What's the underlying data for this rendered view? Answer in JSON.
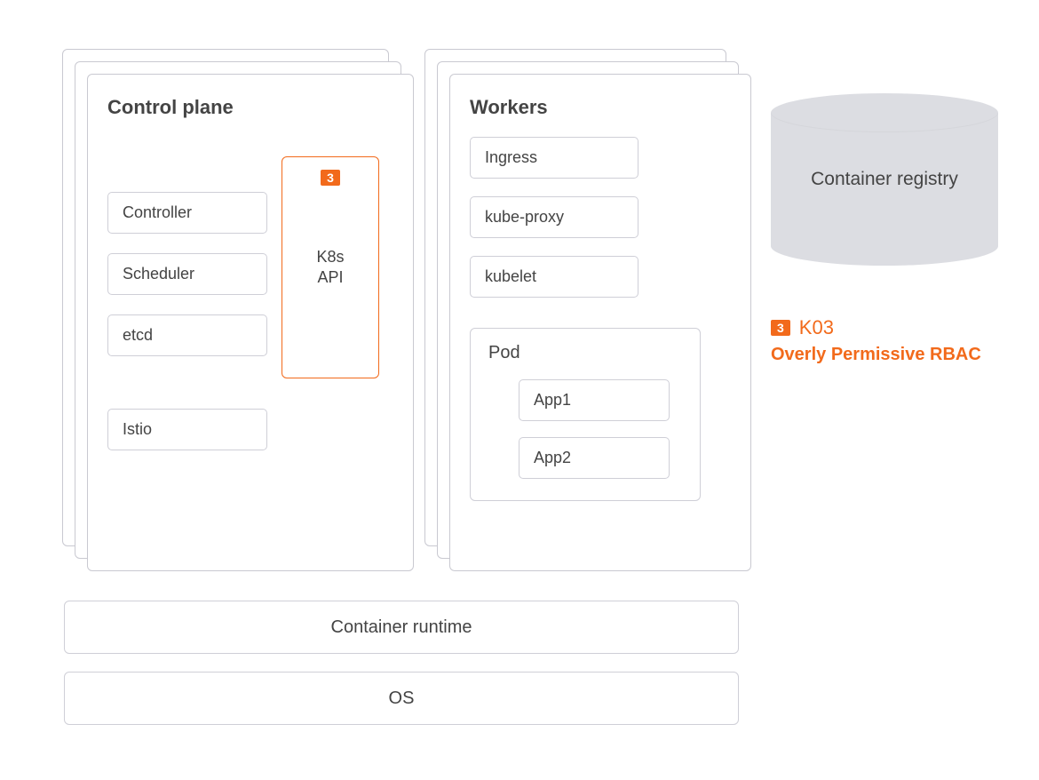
{
  "colors": {
    "accent": "#f26a1b",
    "border": "#c9c9d1",
    "cylinder": "#dcdde2",
    "text": "#333333"
  },
  "controlPlane": {
    "title": "Control plane",
    "left": [
      "Controller",
      "Scheduler",
      "etcd"
    ],
    "api": {
      "badge": "3",
      "label": "K8s\nAPI"
    },
    "below": "Istio"
  },
  "workers": {
    "title": "Workers",
    "items": [
      "Ingress",
      "kube-proxy",
      "kubelet"
    ],
    "pod": {
      "title": "Pod",
      "apps": [
        "App1",
        "App2"
      ]
    }
  },
  "bars": {
    "runtime": "Container runtime",
    "os": "OS"
  },
  "registry": {
    "label": "Container registry"
  },
  "legend": {
    "badge": "3",
    "code": "K03",
    "title": "Overly Permissive RBAC"
  }
}
